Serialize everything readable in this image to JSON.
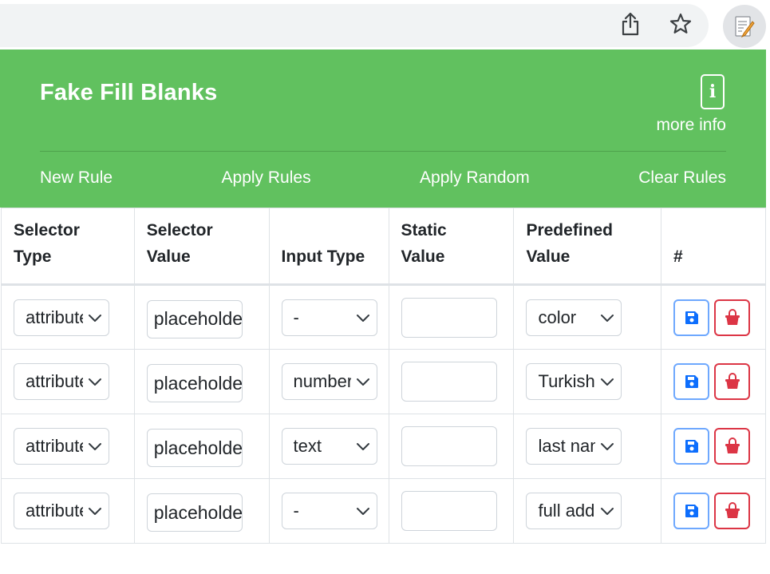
{
  "popup": {
    "title": "Fake Fill Blanks",
    "info_icon_glyph": "i",
    "more_info_label": "more info",
    "nav": [
      "New Rule",
      "Apply Rules",
      "Apply Random",
      "Clear Rules"
    ]
  },
  "table": {
    "headers": [
      [
        "Selector",
        "Type"
      ],
      [
        "Selector",
        "Value"
      ],
      [
        "",
        "Input Type"
      ],
      [
        "Static",
        "Value"
      ],
      [
        "Predefined",
        "Value"
      ],
      [
        "",
        "#"
      ]
    ],
    "rows": [
      {
        "selector_type": "attribute",
        "selector_value": "placeholder",
        "input_type": "-",
        "static_value": "",
        "predefined_value": "color"
      },
      {
        "selector_type": "attribute",
        "selector_value": "placeholder",
        "input_type": "number",
        "static_value": "",
        "predefined_value": "Turkish"
      },
      {
        "selector_type": "attribute",
        "selector_value": "placeholder",
        "input_type": "text",
        "static_value": "",
        "predefined_value": "last name"
      },
      {
        "selector_type": "attribute",
        "selector_value": "placeholder",
        "input_type": "-",
        "static_value": "",
        "predefined_value": "full address"
      }
    ]
  },
  "icons": {
    "share": "share-icon",
    "star": "bookmark-star-icon",
    "extension": "extension-icon",
    "save": "save-floppy-icon",
    "delete": "trash-basket-icon",
    "info": "info-icon",
    "chevron": "chevron-down-icon"
  },
  "colors": {
    "header_bg": "#61c15f",
    "header_text": "#ffffff",
    "save_border": "#6ea8fe",
    "save_icon": "#0d6efd",
    "delete_border": "#dc3545",
    "delete_icon": "#dc3545"
  }
}
